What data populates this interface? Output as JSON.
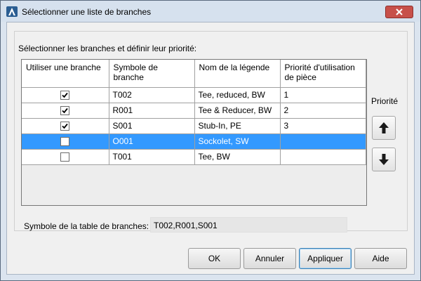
{
  "window": {
    "title": "Sélectionner une liste de branches"
  },
  "instruction": "Sélectionner les branches et définir leur priorité:",
  "table": {
    "columns": [
      "Utiliser une branche",
      "Symbole de branche",
      "Nom de la légende",
      "Priorité d'utilisation de pièce"
    ],
    "rows": [
      {
        "use": true,
        "symbol": "T002",
        "legend": "Tee, reduced, BW",
        "priority": "1",
        "selected": false
      },
      {
        "use": true,
        "symbol": "R001",
        "legend": "Tee & Reducer, BW",
        "priority": "2",
        "selected": false
      },
      {
        "use": true,
        "symbol": "S001",
        "legend": "Stub-In, PE",
        "priority": "3",
        "selected": false
      },
      {
        "use": false,
        "symbol": "O001",
        "legend": "Sockolet, SW",
        "priority": "",
        "selected": true
      },
      {
        "use": false,
        "symbol": "T001",
        "legend": "Tee, BW",
        "priority": "",
        "selected": false
      }
    ]
  },
  "priority": {
    "label": "Priorité",
    "up_icon": "arrow-up-icon",
    "down_icon": "arrow-down-icon"
  },
  "branch_table_symbol": {
    "label": "Symbole de la table de branches:",
    "value": "T002,R001,S001"
  },
  "buttons": {
    "ok": "OK",
    "cancel": "Annuler",
    "apply": "Appliquer",
    "help": "Aide"
  },
  "colors": {
    "selection": "#3399ff",
    "close": "#c7504a",
    "title_bar": "#d6e1ee"
  }
}
